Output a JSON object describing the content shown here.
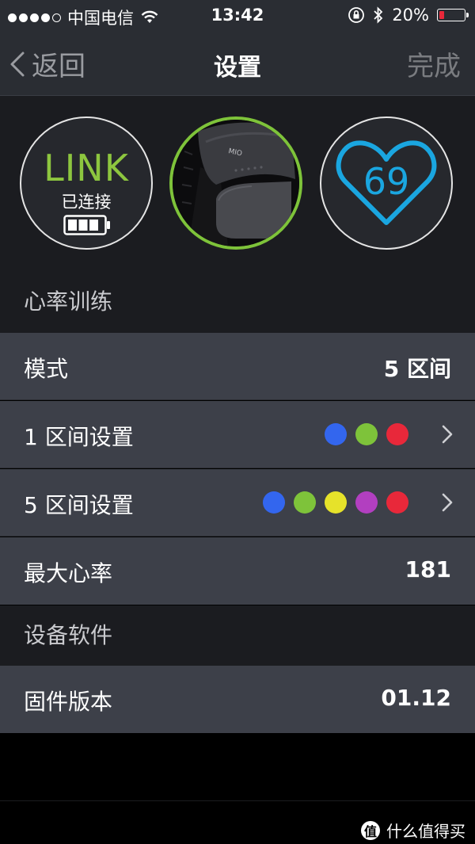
{
  "status_bar": {
    "carrier": "中国电信",
    "time": "13:42",
    "battery_percent": "20%",
    "battery_level": 0.2,
    "signal_bars_filled": 4,
    "signal_bars_total": 5
  },
  "nav": {
    "back_label": "返回",
    "title": "设置",
    "done_label": "完成"
  },
  "device": {
    "name": "LINK",
    "status": "已连接",
    "heart_rate": "69",
    "accent_green": "#8dc63f",
    "accent_blue": "#1aa6e0"
  },
  "sections": {
    "heart_training": "心率训练",
    "device_software": "设备软件"
  },
  "rows": {
    "mode": {
      "label": "模式",
      "value": "5 区间"
    },
    "zone1": {
      "label": "1 区间设置",
      "colors": [
        "#3366ee",
        "#7ec33a",
        "#e8283a"
      ]
    },
    "zone5": {
      "label": "5 区间设置",
      "colors": [
        "#3366ee",
        "#7ec33a",
        "#e6e22a",
        "#b23fc0",
        "#e8283a"
      ]
    },
    "max_hr": {
      "label": "最大心率",
      "value": "181"
    },
    "firmware": {
      "label": "固件版本",
      "value": "01.12"
    }
  },
  "watermark": {
    "badge": "值",
    "text": "什么值得买"
  }
}
